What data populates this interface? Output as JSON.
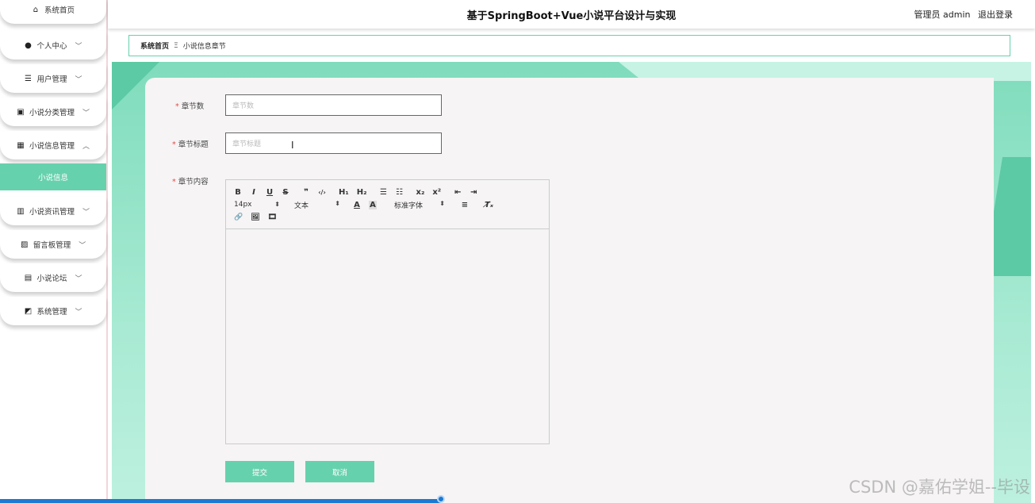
{
  "app": {
    "title": "基于SpringBoot+Vue小说平台设计与实现",
    "user_role": "管理员 admin",
    "logout": "退出登录"
  },
  "sidebar": {
    "items": [
      {
        "label": "系统首页",
        "icon": "home-icon",
        "chevron": ""
      },
      {
        "label": "个人中心",
        "icon": "user-icon",
        "chevron": "﹀"
      },
      {
        "label": "用户管理",
        "icon": "list-icon",
        "chevron": "﹀"
      },
      {
        "label": "小说分类管理",
        "icon": "clipboard-icon",
        "chevron": "﹀"
      },
      {
        "label": "小说信息管理",
        "icon": "grid-icon",
        "chevron": "︿"
      },
      {
        "label": "小说资讯管理",
        "icon": "bar-chart-icon",
        "chevron": "﹀"
      },
      {
        "label": "留言板管理",
        "icon": "clipboard-x-icon",
        "chevron": "﹀"
      },
      {
        "label": "小说论坛",
        "icon": "document-icon",
        "chevron": "﹀"
      },
      {
        "label": "系统管理",
        "icon": "chart-line-icon",
        "chevron": "﹀"
      }
    ],
    "active_sub": "小说信息"
  },
  "breadcrumb": {
    "home": "系统首页",
    "separator": "Ξ",
    "current": "小说信息章节"
  },
  "form": {
    "chapter_num": {
      "label": "章节数",
      "placeholder": "章节数"
    },
    "chapter_title": {
      "label": "章节标题",
      "placeholder": "章节标题"
    },
    "chapter_content": {
      "label": "章节内容"
    },
    "required_mark": "*",
    "submit": "提交",
    "cancel": "取消"
  },
  "editor": {
    "row1": [
      "B",
      "I",
      "U",
      "S",
      "❞",
      "‹/›",
      "H₁",
      "H₂",
      "☰",
      "☷",
      "x₂",
      "x²",
      "⇤",
      "⇥"
    ],
    "font_size": "14px",
    "block_type": "文本",
    "font_family": "标准字体",
    "select_arrow": "⬍",
    "color_a": "A",
    "bg_a": "A",
    "align": "≡",
    "clear": "T̸ₓ",
    "row3": [
      "🔗",
      "🖼",
      "🎞"
    ]
  },
  "watermark": "CSDN @嘉佑学姐--毕设",
  "colors": {
    "accent": "#66d1ad",
    "progress": "#1a7ad4",
    "required": "#e24b4b"
  }
}
